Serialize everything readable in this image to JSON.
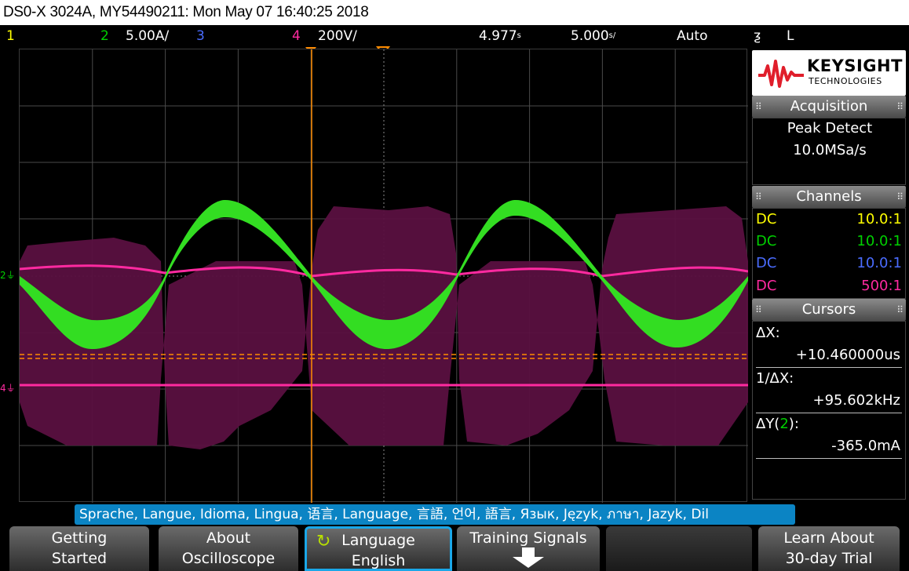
{
  "title": "DS0-X 3024A, MY54490211: Mon May 07 16:40:25 2018",
  "status": {
    "ch1": "1",
    "ch2": "2",
    "ch2_scale": "5.00A/",
    "ch3": "3",
    "ch4": "4",
    "ch4_scale": "200V/",
    "delay": "4.977",
    "delay_unit": "s",
    "timebase": "5.000",
    "timebase_unit": "s/",
    "trigger_mode": "Auto",
    "trigger_slope_icon": "trigger-falling-edge",
    "trigger_source": "L"
  },
  "colors": {
    "ch1": "#ffff00",
    "ch2": "#00d000",
    "ch3": "#4a6cff",
    "ch4": "#ff2aa0",
    "cursor": "#ff8c00",
    "grid": "#555555"
  },
  "graticule": {
    "ch2_marker": "2",
    "ch4_marker": "4"
  },
  "panel": {
    "logo_main": "KEYSIGHT",
    "logo_sub": "TECHNOLOGIES",
    "acquisition": {
      "title": "Acquisition",
      "mode": "Peak Detect",
      "rate": "10.0MSa/s"
    },
    "channels": {
      "title": "Channels",
      "rows": [
        {
          "coupling": "DC",
          "probe": "10.0:1",
          "color": "#ffff00"
        },
        {
          "coupling": "DC",
          "probe": "10.0:1",
          "color": "#00d000"
        },
        {
          "coupling": "DC",
          "probe": "10.0:1",
          "color": "#4a6cff"
        },
        {
          "coupling": "DC",
          "probe": "500:1",
          "color": "#ff2aa0"
        }
      ]
    },
    "cursors": {
      "title": "Cursors",
      "dx_label": "ΔX:",
      "dx_value": "+10.460000us",
      "inv_label": "1/ΔX:",
      "inv_value": "+95.602kHz",
      "dy_label_prefix": "ΔY(",
      "dy_label_ch": "2",
      "dy_label_suffix": "):",
      "dy_value": "-365.0mA"
    }
  },
  "language_banner": "Sprache, Langue, Idioma, Lingua, 语言, Language, 言語, 언어, 語言, Язык, Język, ภาษา, Jazyk, Dil",
  "softkeys": [
    {
      "line1": "Getting",
      "line2": "Started"
    },
    {
      "line1": "About",
      "line2": "Oscilloscope"
    },
    {
      "line1": "Language",
      "line2": "English",
      "icon": "rotate-icon"
    },
    {
      "line1": "Training Signals",
      "line2": "",
      "icon": "down-arrow-icon"
    },
    {
      "line1": "",
      "line2": ""
    },
    {
      "line1": "Learn About",
      "line2": "30-day Trial"
    }
  ]
}
